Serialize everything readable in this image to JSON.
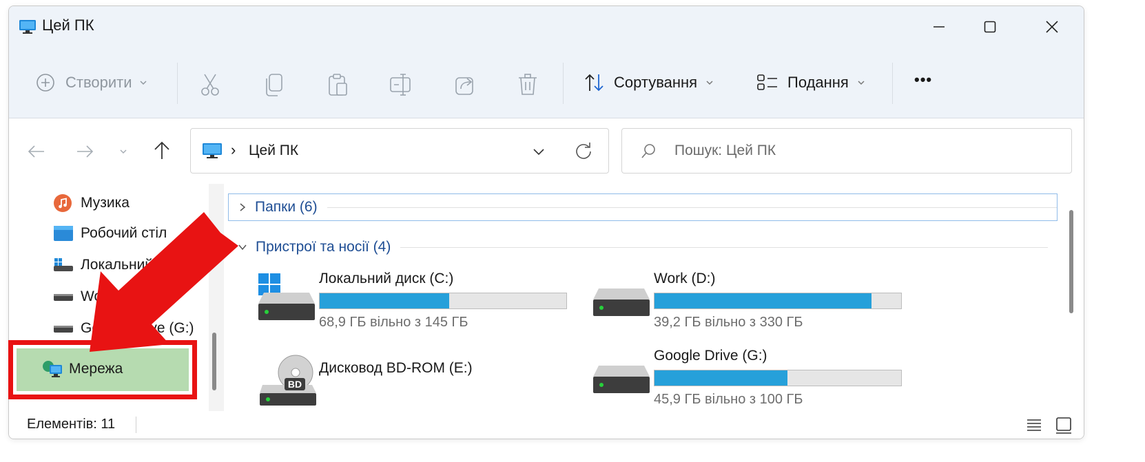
{
  "window": {
    "title": "Цей ПК"
  },
  "toolbar": {
    "create_label": "Створити",
    "sort_label": "Сортування",
    "view_label": "Подання",
    "more_label": "•••"
  },
  "address": {
    "path": "Цей ПК",
    "separator": "›"
  },
  "search": {
    "placeholder": "Пошук: Цей ПК"
  },
  "sidebar": {
    "items": [
      {
        "label": "Музика",
        "icon": "music-icon"
      },
      {
        "label": "Робочий стіл",
        "icon": "desktop-folder-icon"
      },
      {
        "label": "Локальний",
        "icon": "local-disk-icon"
      },
      {
        "label": "Work",
        "icon": "drive-icon"
      },
      {
        "label": "Google Drive (G:)",
        "icon": "drive-icon"
      },
      {
        "label": "Мережа",
        "icon": "network-icon"
      }
    ]
  },
  "groups": {
    "folders": "Папки (6)",
    "devices": "Пристрої та носії (4)"
  },
  "drives": [
    {
      "name": "Локальний диск (C:)",
      "free": "68,9 ГБ вільно з 145 ГБ",
      "used_fraction": 0.525
    },
    {
      "name": "Work (D:)",
      "free": "39,2 ГБ вільно з 330 ГБ",
      "used_fraction": 0.88
    },
    {
      "name": "Дисковод BD-ROM (E:)",
      "free": "",
      "disc_label": "BD"
    },
    {
      "name": "Google Drive (G:)",
      "free": "45,9 ГБ вільно з 100 ГБ",
      "used_fraction": 0.54
    }
  ],
  "status": {
    "items_text": "Елементів: 11"
  },
  "colors": {
    "accent_bar": "#26a0da",
    "highlight_border": "#e81313",
    "highlight_fill": "#b6dbb0"
  }
}
